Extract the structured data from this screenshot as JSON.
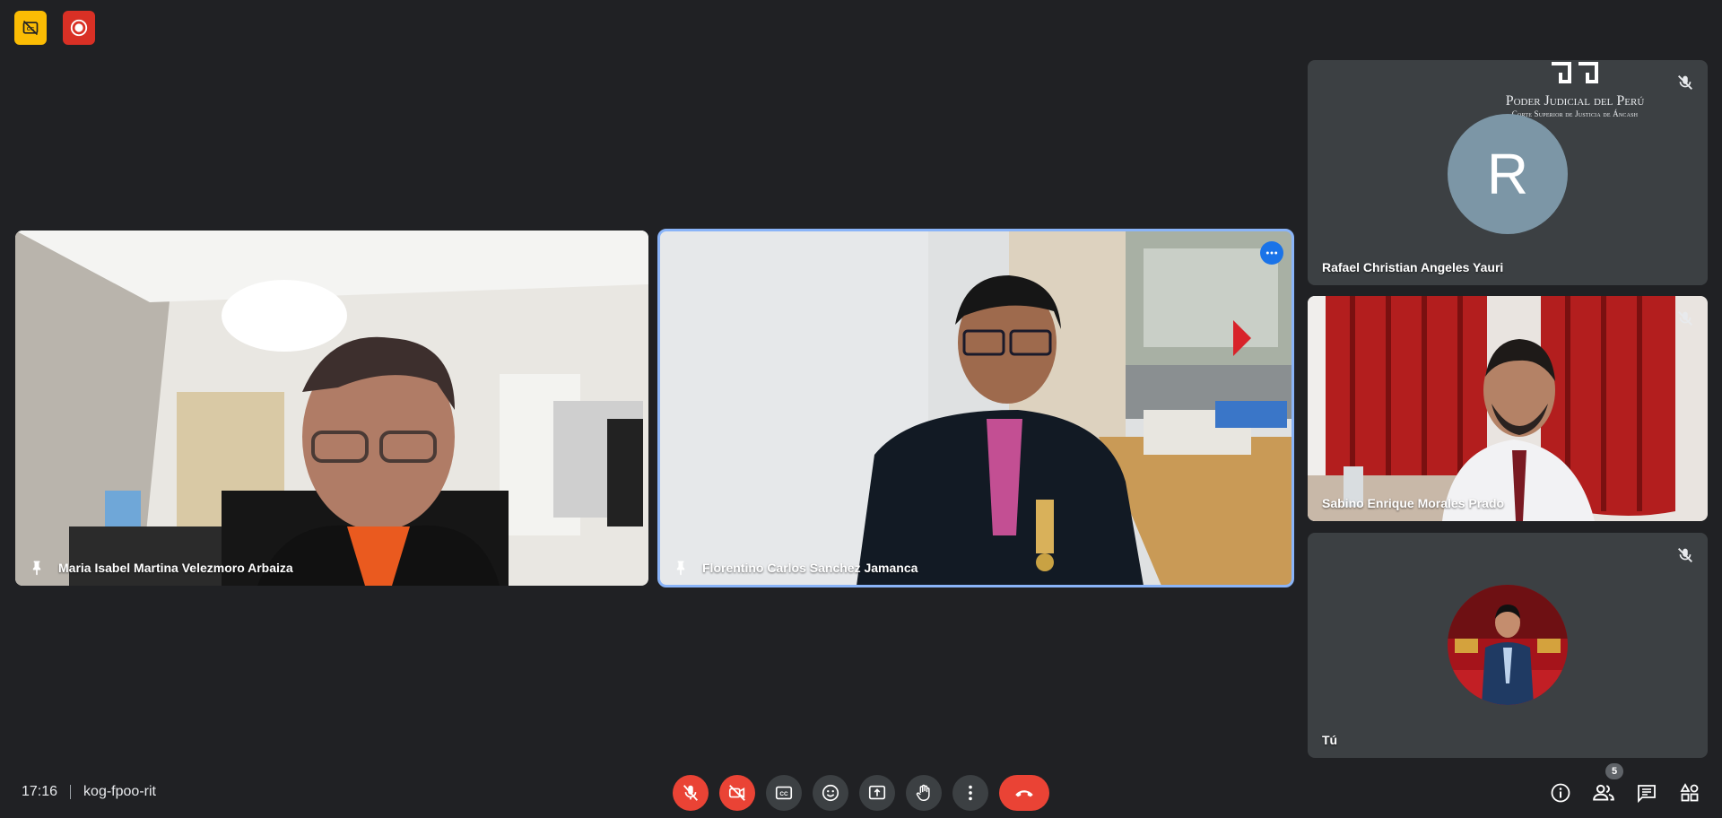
{
  "indicators": {
    "captions_icon": "closed-captions-off-icon",
    "record_icon": "recording-icon"
  },
  "participants": [
    {
      "name": "Maria Isabel Martina Velezmoro Arbaiza",
      "pinned": true
    },
    {
      "name": "Florentino Carlos Sanchez Jamanca",
      "pinned": true,
      "active": true
    },
    {
      "name": "Rafael Christian Angeles Yauri",
      "avatar_letter": "R",
      "muted": true
    },
    {
      "name": "Sabino Enrique Morales Prado",
      "muted": true
    },
    {
      "name": "Tú",
      "muted": true
    }
  ],
  "watermark": {
    "title": "Poder Judicial del Perú",
    "subtitle": "Corte Superior de Justicia de Áncash"
  },
  "bottom": {
    "time": "17:16",
    "meeting_code": "kog-fpoo-rit",
    "people_count": "5"
  },
  "colors": {
    "background": "#202124",
    "tile": "#3c4043",
    "danger": "#ea4335",
    "active_outline": "#8ab4f8",
    "indicator_yellow": "#fbbc04"
  }
}
